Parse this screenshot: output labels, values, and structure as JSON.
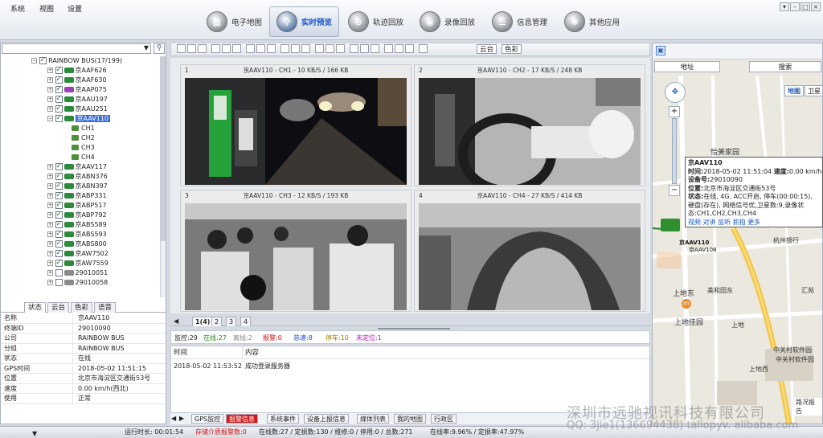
{
  "menu": [
    "系统",
    "视图",
    "设置"
  ],
  "nav": [
    {
      "label": "电子地图",
      "icon": "map-icon",
      "active": false
    },
    {
      "label": "实时预览",
      "icon": "magnifier-icon",
      "active": true
    },
    {
      "label": "轨迹回放",
      "icon": "track-icon",
      "active": false
    },
    {
      "label": "录像回放",
      "icon": "record-icon",
      "active": false
    },
    {
      "label": "信息管理",
      "icon": "info-icon",
      "active": false
    },
    {
      "label": "其他应用",
      "icon": "apps-icon",
      "active": false
    }
  ],
  "tree": {
    "root": "RAINBOW BUS(17/199)",
    "items": [
      {
        "label": "京AAF626",
        "color": "#2c8a3a",
        "checked": true
      },
      {
        "label": "京AAF630",
        "color": "#2c8a3a",
        "checked": true
      },
      {
        "label": "京AAP075",
        "color": "#9c3fb0",
        "checked": true
      },
      {
        "label": "京AAU197",
        "color": "#2c8a3a",
        "checked": true
      },
      {
        "label": "京AAU251",
        "color": "#2c8a3a",
        "checked": true
      },
      {
        "label": "京AAV110",
        "color": "#2c8a3a",
        "checked": true,
        "selected": true,
        "expanded": true
      },
      {
        "label": "CH1",
        "channel": true
      },
      {
        "label": "CH2",
        "channel": true
      },
      {
        "label": "CH3",
        "channel": true
      },
      {
        "label": "CH4",
        "channel": true
      },
      {
        "label": "京AAV117",
        "color": "#2c8a3a",
        "checked": true
      },
      {
        "label": "京ABN376",
        "color": "#2c8a3a",
        "checked": true
      },
      {
        "label": "京ABN397",
        "color": "#2c8a3a",
        "checked": true
      },
      {
        "label": "京ABP331",
        "color": "#2c8a3a",
        "checked": true
      },
      {
        "label": "京ABP517",
        "color": "#2c8a3a",
        "checked": true
      },
      {
        "label": "京ABP792",
        "color": "#2c8a3a",
        "checked": true
      },
      {
        "label": "京ABS589",
        "color": "#2c8a3a",
        "checked": true
      },
      {
        "label": "京ABS593",
        "color": "#2c8a3a",
        "checked": true
      },
      {
        "label": "京ABS800",
        "color": "#2c8a3a",
        "checked": true
      },
      {
        "label": "京AW7502",
        "color": "#2c8a3a",
        "checked": true
      },
      {
        "label": "京AW7559",
        "color": "#2c8a3a",
        "checked": true
      },
      {
        "label": "29010051",
        "color": "#8a8a8a",
        "checked": false
      },
      {
        "label": "29010058",
        "color": "#8a8a8a",
        "checked": false
      }
    ]
  },
  "left_tabs": [
    "状态",
    "云台",
    "色彩",
    "语音"
  ],
  "props": [
    {
      "k": "名称",
      "v": "京AAV110"
    },
    {
      "k": "终端ID",
      "v": "29010090"
    },
    {
      "k": "公司",
      "v": "RAINBOW BUS"
    },
    {
      "k": "分组",
      "v": "RAINBOW BUS"
    },
    {
      "k": "状态",
      "v": "在线"
    },
    {
      "k": "GPS时间",
      "v": "2018-05-02 11:51:15"
    },
    {
      "k": "位置",
      "v": "北京市海淀区交通街53号"
    },
    {
      "k": "速度",
      "v": "0.00 km/h(西北)"
    },
    {
      "k": "使用",
      "v": "正常"
    }
  ],
  "toolbar": {
    "ptz": "云台",
    "color": "色彩"
  },
  "videos": [
    {
      "num": "1",
      "title": "京AAV110 - CH1 - 10 KB/S / 166 KB"
    },
    {
      "num": "2",
      "title": "京AAV110 - CH2 - 17 KB/S / 248 KB"
    },
    {
      "num": "3",
      "title": "京AAV110 - CH3 - 12 KB/S / 193 KB"
    },
    {
      "num": "4",
      "title": "京AAV110 - CH4 - 27 KB/S / 414 KB"
    }
  ],
  "video_tabs": [
    "1(4)",
    "2",
    "3",
    "4"
  ],
  "status_counts": [
    {
      "label": "监控:29",
      "color": "#222"
    },
    {
      "label": "在线:27",
      "color": "#1a8a1a"
    },
    {
      "label": "离线:2",
      "color": "#888"
    },
    {
      "label": "报警:0",
      "color": "#d01010"
    },
    {
      "label": "怠速:8",
      "color": "#1a4ad0"
    },
    {
      "label": "停车:10",
      "color": "#a07a00"
    },
    {
      "label": "未定位:1",
      "color": "#c010c0"
    }
  ],
  "log": {
    "headers": [
      "时间",
      "内容"
    ],
    "rows": [
      {
        "time": "2018-05-02 11:53:52",
        "content": "成功登录服务器"
      }
    ]
  },
  "bottom_tabs": [
    "GPS监控",
    "报警信息",
    "系统事件",
    "设备上报信息",
    "媒体列表",
    "我的地图",
    "行政区"
  ],
  "statusbar": {
    "run_time": "运行时长: 00:01:54",
    "storage_alarm": "存储介质报警数:0",
    "online": "在线数:27 / 定损数:130 / 维修:0 / 停用:0 / 总数:271",
    "rate": "在线率:9.96% / 定损率:47.97%"
  },
  "map": {
    "address_btn": "地址",
    "search_btn": "搜索",
    "map_type": "地图",
    "sat_type": "卫星",
    "labels": [
      "怡美家园",
      "上地东",
      "上地佳园",
      "杭州银行",
      "美和园东",
      "汇苑",
      "上地",
      "中关村软件园",
      "上地西",
      "中关村软件园",
      "路况报告"
    ],
    "popup": {
      "title": "京AAV110",
      "time_label": "时间:",
      "time": "2018-05-02 11:51:04",
      "speed_label": "速度:",
      "speed": "0.00 km/h",
      "device_label": "设备号:",
      "device": "29010090",
      "pos_label": "位置:",
      "pos": "北京市海淀区交通街53号",
      "state_label": "状态:",
      "state": "在线, 4G, ACC开启, 停车(00:00:15), 硬盘(存在), 网络信号优,卫星数:9,录像状态:CH1,CH2,CH3,CH4",
      "links": [
        "视频",
        "对讲",
        "监听",
        "抓拍",
        "更多"
      ]
    },
    "marker_label": "京AAV110",
    "marker_label2": "京AAV108"
  },
  "watermark": "深圳市远驰视讯科技有限公司",
  "watermark2": "QQ: 3jie1(136694438)  tallopyv. alibaba.com"
}
